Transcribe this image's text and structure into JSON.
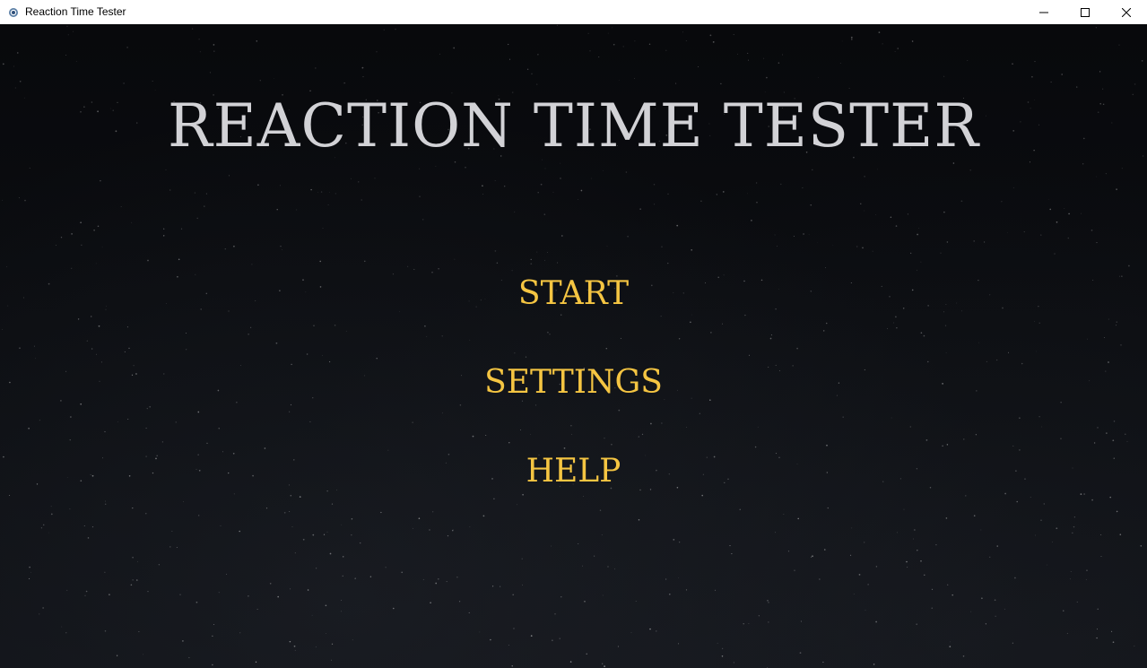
{
  "window": {
    "title": "Reaction Time Tester",
    "app_icon": "app-icon",
    "controls": {
      "minimize_icon": "minimize-icon",
      "maximize_icon": "maximize-icon",
      "close_icon": "close-icon"
    }
  },
  "game": {
    "title": "REACTION TIME TESTER",
    "menu": [
      {
        "id": "start",
        "label": "START"
      },
      {
        "id": "settings",
        "label": "SETTINGS"
      },
      {
        "id": "help",
        "label": "HELP"
      }
    ]
  },
  "colors": {
    "title_text": "#d2d2d6",
    "menu_text": "#f5c542",
    "background": "#0b0d10"
  }
}
